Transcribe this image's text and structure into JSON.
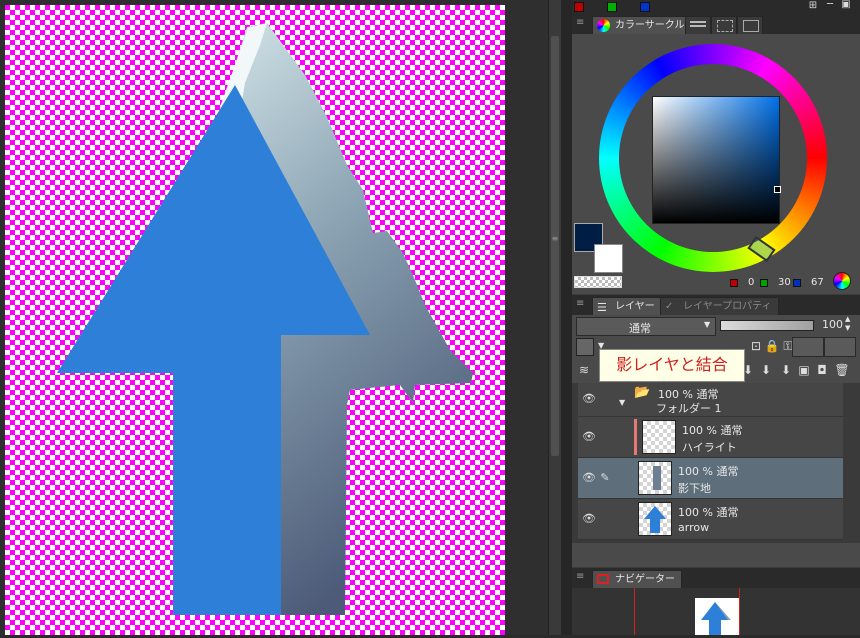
{
  "color_panel": {
    "tab_label": "カラーサークル",
    "r_value": "0",
    "g_value": "30",
    "b_value": "67",
    "main_color": "#001e43",
    "sub_color": "#ffffff"
  },
  "layer_panel": {
    "tab_layer": "レイヤー",
    "tab_property": "レイヤープロパティ",
    "blend_mode": "通常",
    "opacity": "100",
    "tooltip": "影レイヤと結合",
    "layers": [
      {
        "blend": "100 % 通常",
        "name": "フォルダー 1"
      },
      {
        "blend": "100 % 通常",
        "name": "ハイライト"
      },
      {
        "blend": "100 % 通常",
        "name": "影下地"
      },
      {
        "blend": "100 % 通常",
        "name": "arrow"
      }
    ]
  },
  "navigator": {
    "tab_label": "ナビゲーター"
  }
}
